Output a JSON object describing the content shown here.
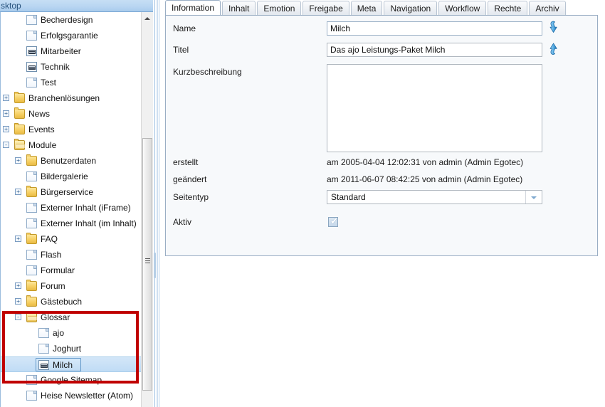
{
  "window": {
    "top_tab_label": "sktop"
  },
  "tree": {
    "scrollbar": {
      "up_icon": "scroll-up-arrow-icon",
      "grip_icon": "scroll-grip-icon"
    },
    "items": [
      {
        "label": "Becherdesign",
        "depth": 2,
        "icon": "document-icon",
        "expander": "",
        "selected": false
      },
      {
        "label": "Erfolgsgarantie",
        "depth": 2,
        "icon": "document-icon",
        "expander": "",
        "selected": false
      },
      {
        "label": "Mitarbeiter",
        "depth": 2,
        "icon": "glossary-document-icon",
        "expander": "",
        "selected": false
      },
      {
        "label": "Technik",
        "depth": 2,
        "icon": "glossary-document-icon",
        "expander": "",
        "selected": false
      },
      {
        "label": "Test",
        "depth": 2,
        "icon": "document-icon",
        "expander": "",
        "selected": false
      },
      {
        "label": "Branchenlösungen",
        "depth": 1,
        "icon": "folder-icon",
        "expander": "+",
        "selected": false
      },
      {
        "label": "News",
        "depth": 1,
        "icon": "folder-icon",
        "expander": "+",
        "selected": false
      },
      {
        "label": "Events",
        "depth": 1,
        "icon": "folder-icon",
        "expander": "+",
        "selected": false
      },
      {
        "label": "Module",
        "depth": 1,
        "icon": "folder-open-icon",
        "expander": "-",
        "selected": false
      },
      {
        "label": "Benutzerdaten",
        "depth": 2,
        "icon": "folder-icon",
        "expander": "+",
        "selected": false
      },
      {
        "label": "Bildergalerie",
        "depth": 2,
        "icon": "document-icon",
        "expander": "",
        "selected": false
      },
      {
        "label": "Bürgerservice",
        "depth": 2,
        "icon": "folder-icon",
        "expander": "+",
        "selected": false
      },
      {
        "label": "Externer Inhalt (iFrame)",
        "depth": 2,
        "icon": "document-icon",
        "expander": "",
        "selected": false
      },
      {
        "label": "Externer Inhalt (im Inhalt)",
        "depth": 2,
        "icon": "document-icon",
        "expander": "",
        "selected": false
      },
      {
        "label": "FAQ",
        "depth": 2,
        "icon": "folder-icon",
        "expander": "+",
        "selected": false
      },
      {
        "label": "Flash",
        "depth": 2,
        "icon": "document-icon",
        "expander": "",
        "selected": false
      },
      {
        "label": "Formular",
        "depth": 2,
        "icon": "document-icon",
        "expander": "",
        "selected": false
      },
      {
        "label": "Forum",
        "depth": 2,
        "icon": "folder-icon",
        "expander": "+",
        "selected": false
      },
      {
        "label": "Gästebuch",
        "depth": 2,
        "icon": "folder-icon",
        "expander": "+",
        "selected": false
      },
      {
        "label": "Glossar",
        "depth": 2,
        "icon": "folder-open-icon",
        "expander": "-",
        "selected": false
      },
      {
        "label": "ajo",
        "depth": 3,
        "icon": "document-icon",
        "expander": "",
        "selected": false
      },
      {
        "label": "Joghurt",
        "depth": 3,
        "icon": "document-icon",
        "expander": "",
        "selected": false
      },
      {
        "label": "Milch",
        "depth": 3,
        "icon": "glossary-document-icon",
        "expander": "",
        "selected": true
      },
      {
        "label": "Google Sitemap",
        "depth": 2,
        "icon": "document-icon",
        "expander": "",
        "selected": false
      },
      {
        "label": "Heise Newsletter (Atom)",
        "depth": 2,
        "icon": "document-icon",
        "expander": "",
        "selected": false
      }
    ]
  },
  "tabs": [
    {
      "label": "Information",
      "active": true
    },
    {
      "label": "Inhalt",
      "active": false
    },
    {
      "label": "Emotion",
      "active": false
    },
    {
      "label": "Freigabe",
      "active": false
    },
    {
      "label": "Meta",
      "active": false
    },
    {
      "label": "Navigation",
      "active": false
    },
    {
      "label": "Workflow",
      "active": false
    },
    {
      "label": "Rechte",
      "active": false
    },
    {
      "label": "Archiv",
      "active": false
    }
  ],
  "form": {
    "name": {
      "label": "Name",
      "value": "Milch",
      "placeholder": "",
      "arrow_icon": "arrow-down-icon"
    },
    "titel": {
      "label": "Titel",
      "value": "Das ajo Leistungs-Paket Milch",
      "placeholder": "",
      "arrow_icon": "arrow-up-icon"
    },
    "kurzbeschreibung": {
      "label": "Kurzbeschreibung",
      "value": "",
      "placeholder": ""
    },
    "erstellt": {
      "label": "erstellt",
      "value": "am 2005-04-04 12:02:31 von admin (Admin Egotec)"
    },
    "geaendert": {
      "label": "geändert",
      "value": "am 2011-06-07 08:42:25 von admin (Admin Egotec)"
    },
    "seitentyp": {
      "label": "Seitentyp",
      "value": "Standard",
      "options": [
        "Standard"
      ],
      "arrow_icon": "chevron-down-icon"
    },
    "aktiv": {
      "label": "Aktiv",
      "checked": true,
      "tick": "✔"
    }
  },
  "annotation": {
    "color": "#c00000",
    "name": "red-highlight-rectangle"
  }
}
